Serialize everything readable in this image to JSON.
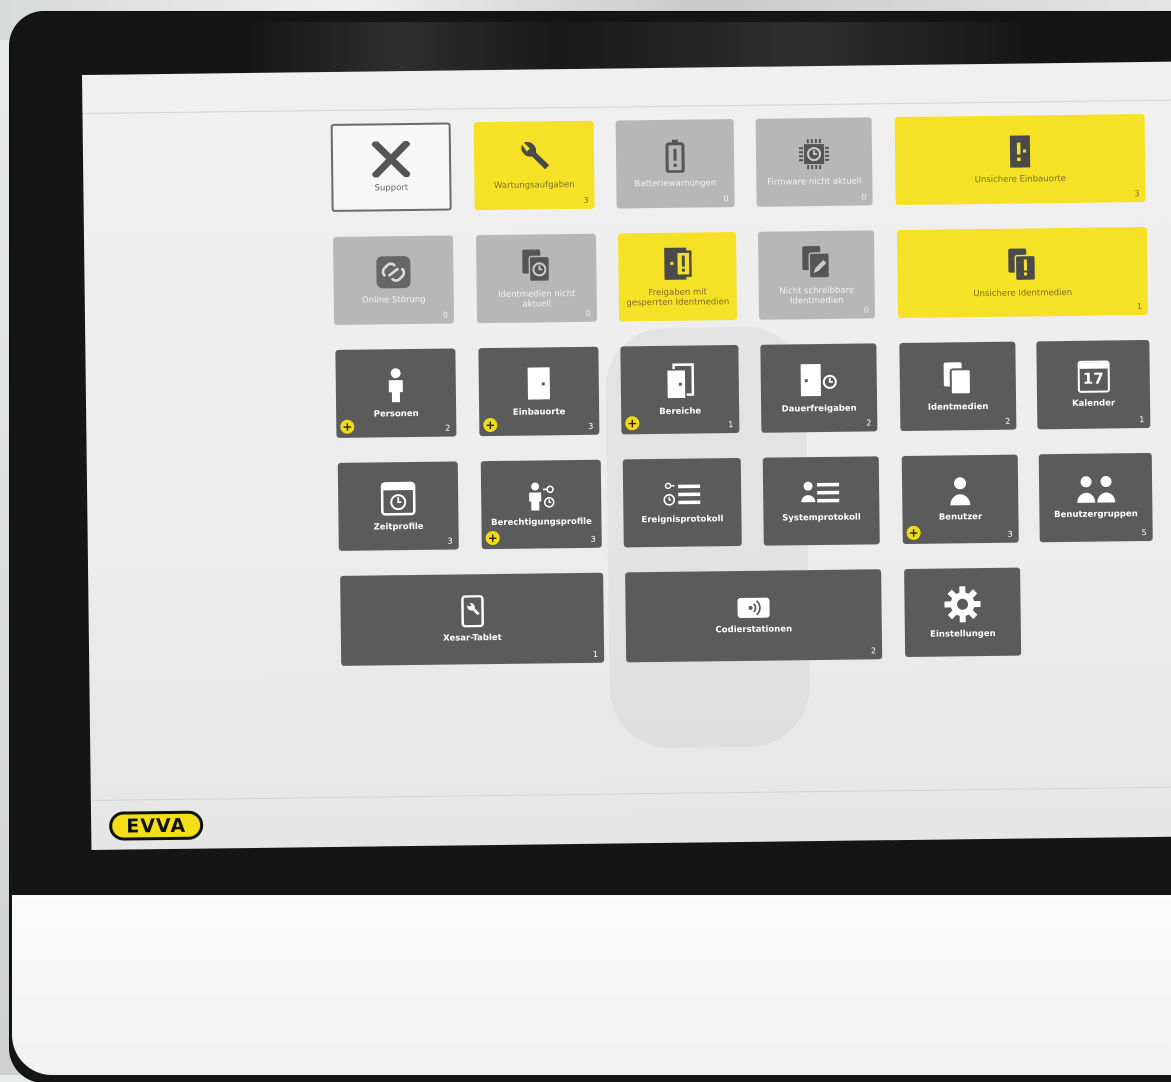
{
  "app": {
    "logo_text": "EVVA"
  },
  "colors": {
    "accent_yellow": "#f5e227",
    "tile_dark": "#5b5b5b",
    "tile_grey": "#b7b7b7"
  },
  "tiles": {
    "support": {
      "label": "Support",
      "icon": "close-x-icon"
    },
    "wartung": {
      "label": "Wartungsaufgaben",
      "count": "3",
      "icon": "wrench-icon"
    },
    "batterie": {
      "label": "Batteriewarnungen",
      "count": "0",
      "icon": "battery-warning-icon"
    },
    "firmware": {
      "label": "Firmware nicht aktuell",
      "count": "0",
      "icon": "chip-icon"
    },
    "unsichere_einbauorte": {
      "label": "Unsichere Einbauorte",
      "count": "3",
      "icon": "door-warning-icon"
    },
    "online_stoerung": {
      "label": "Online Störung",
      "count": "0",
      "icon": "link-icon"
    },
    "identmedien_nicht_aktuell": {
      "label": "Identmedien nicht aktuell",
      "count": "0",
      "icon": "cards-clock-icon"
    },
    "freigaben_gesperrt": {
      "label": "Freigaben mit gesperrten Identmedien",
      "icon": "door-exclamation-icon"
    },
    "nicht_schreibbar": {
      "label": "Nicht schreibbare Identmedien",
      "count": "0",
      "icon": "cards-pencil-icon"
    },
    "unsichere_identmedien": {
      "label": "Unsichere Identmedien",
      "count": "1",
      "icon": "cards-warning-icon"
    },
    "personen": {
      "label": "Personen",
      "count": "2",
      "icon": "person-icon"
    },
    "einbauorte": {
      "label": "Einbauorte",
      "count": "3",
      "icon": "door-icon"
    },
    "bereiche": {
      "label": "Bereiche",
      "count": "1",
      "icon": "doors-icon"
    },
    "dauerfreigaben": {
      "label": "Dauerfreigaben",
      "count": "2",
      "icon": "door-clock-icon"
    },
    "identmedien": {
      "label": "Identmedien",
      "count": "2",
      "icon": "cards-icon"
    },
    "kalender": {
      "label": "Kalender",
      "count": "1",
      "day": "17",
      "icon": "calendar-icon"
    },
    "zeitprofile": {
      "label": "Zeitprofile",
      "count": "3",
      "icon": "calendar-clock-icon"
    },
    "berechtigungsprofile": {
      "label": "Berechtigungsprofile",
      "count": "3",
      "icon": "person-key-icon"
    },
    "ereignisprotokoll": {
      "label": "Ereignisprotokoll",
      "icon": "event-log-icon"
    },
    "systemprotokoll": {
      "label": "Systemprotokoll",
      "icon": "system-log-icon"
    },
    "benutzer": {
      "label": "Benutzer",
      "count": "3",
      "icon": "user-icon"
    },
    "benutzergruppen": {
      "label": "Benutzergruppen",
      "count": "5",
      "icon": "user-group-icon"
    },
    "xesar_tablet": {
      "label": "Xesar-Tablet",
      "count": "1",
      "icon": "tablet-wrench-icon"
    },
    "codierstationen": {
      "label": "Codierstationen",
      "count": "2",
      "icon": "coding-station-icon"
    },
    "einstellungen": {
      "label": "Einstellungen",
      "icon": "gear-icon"
    }
  },
  "add_button_glyph": "+"
}
